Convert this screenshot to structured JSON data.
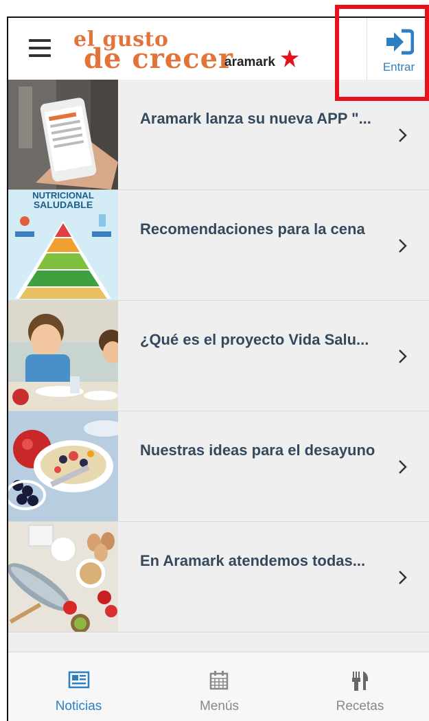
{
  "header": {
    "logo_line1": "el gusto",
    "logo_line2": "de crecer",
    "brand": "aramark",
    "login_label": "Entrar"
  },
  "news": [
    {
      "title": "Aramark lanza su nueva APP \"..."
    },
    {
      "title": "Recomendaciones para la cena"
    },
    {
      "title": "¿Qué es el proyecto Vida Salu..."
    },
    {
      "title": "Nuestras ideas para el desayuno"
    },
    {
      "title": "En Aramark atendemos todas..."
    }
  ],
  "thumb_texts": {
    "pyramid_line1": "NUTRICIONAL",
    "pyramid_line2": "SALUDABLE"
  },
  "tabs": [
    {
      "label": "Noticias",
      "active": true
    },
    {
      "label": "Menús",
      "active": false
    },
    {
      "label": "Recetas",
      "active": false
    }
  ],
  "colors": {
    "accent": "#2c7fc2",
    "logo": "#e2743a",
    "title": "#34495e",
    "highlight": "#e8101a"
  }
}
